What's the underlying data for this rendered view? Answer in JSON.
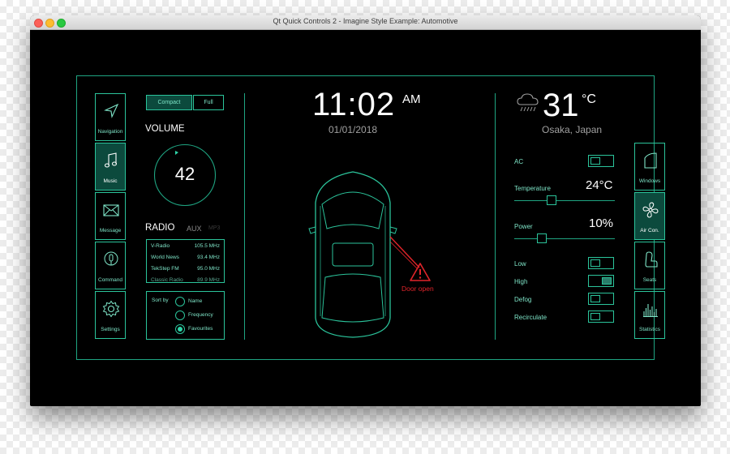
{
  "window": {
    "title": "Qt Quick Controls 2 - Imagine Style Example: Automotive"
  },
  "nav": [
    {
      "label": "Navigation",
      "icon": "navigation-icon",
      "active": false
    },
    {
      "label": "Music",
      "icon": "music-icon",
      "active": true
    },
    {
      "label": "Message",
      "icon": "message-icon",
      "active": false
    },
    {
      "label": "Command",
      "icon": "microphone-icon",
      "active": false
    },
    {
      "label": "Settings",
      "icon": "gear-icon",
      "active": false
    }
  ],
  "modes": {
    "compact": "Compact",
    "full": "Full",
    "selected": "Compact"
  },
  "volume": {
    "label": "VOLUME",
    "value": "42"
  },
  "radio": {
    "label": "RADIO",
    "aux": "AUX",
    "mp3": "MP3",
    "stations": [
      {
        "name": "V-Radio",
        "freq": "105.5 MHz"
      },
      {
        "name": "World News",
        "freq": "93.4 MHz"
      },
      {
        "name": "TekStep FM",
        "freq": "95.0 MHz"
      },
      {
        "name": "Classic Radio",
        "freq": "89.9 MHz"
      }
    ]
  },
  "sort": {
    "label": "Sort by",
    "options": [
      "Name",
      "Frequency",
      "Favourites"
    ],
    "selected": "Favourites"
  },
  "clock": {
    "time": "11:02",
    "ampm": "AM",
    "date": "01/01/2018"
  },
  "alert": {
    "text": "Door open"
  },
  "weather": {
    "temp": "31",
    "unit": "°C",
    "location": "Osaka, Japan",
    "icon": "cloud-rain-icon"
  },
  "climate": {
    "ac": {
      "label": "AC",
      "on": false
    },
    "temperature": {
      "label": "Temperature",
      "value": "24°C",
      "level": 0.45
    },
    "power": {
      "label": "Power",
      "value": "10%",
      "level": 0.35
    },
    "low": {
      "label": "Low",
      "on": false
    },
    "high": {
      "label": "High",
      "on": true
    },
    "defog": {
      "label": "Defog",
      "on": false
    },
    "recirculate": {
      "label": "Recirculate",
      "on": false
    }
  },
  "right_nav": [
    {
      "label": "Windows",
      "icon": "window-icon",
      "active": false
    },
    {
      "label": "Air Con.",
      "icon": "fan-icon",
      "active": true
    },
    {
      "label": "Seats",
      "icon": "seat-icon",
      "active": false
    },
    {
      "label": "Statistics",
      "icon": "statistics-icon",
      "active": false
    }
  ],
  "colors": {
    "accent": "#2bc49b",
    "background": "#000000",
    "alert": "#e0242a"
  }
}
